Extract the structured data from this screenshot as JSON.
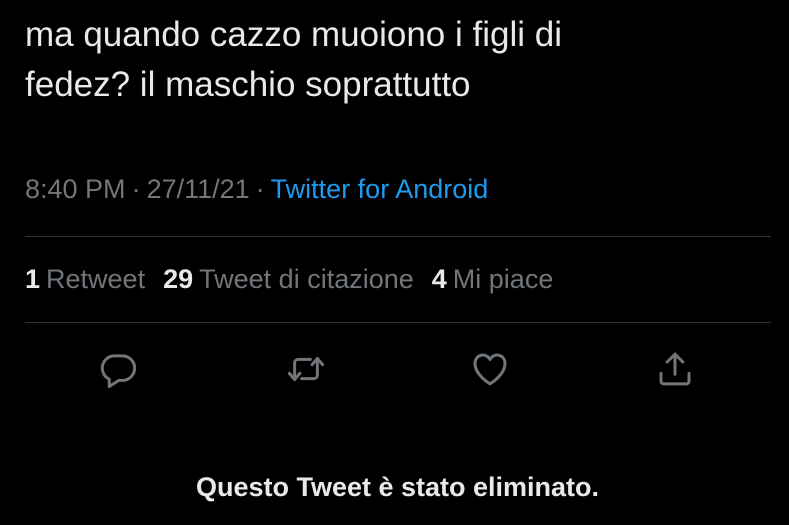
{
  "tweet": {
    "text": "ma quando cazzo muoiono i figli di\nfedez? il maschio soprattutto"
  },
  "meta": {
    "time": "8:40 PM",
    "separator": "·",
    "date": "27/11/21",
    "source": "Twitter for Android"
  },
  "stats": {
    "retweets_count": "1",
    "retweets_label": "Retweet",
    "quotes_count": "29",
    "quotes_label": "Tweet di citazione",
    "likes_count": "4",
    "likes_label": "Mi piace"
  },
  "actions": [
    {
      "icon": "reply-icon"
    },
    {
      "icon": "retweet-icon"
    },
    {
      "icon": "like-icon"
    },
    {
      "icon": "share-icon"
    }
  ],
  "notice": {
    "deleted": "Questo Tweet è stato eliminato."
  },
  "colors": {
    "background": "#000000",
    "text": "#e7e9ea",
    "secondary": "#71767b",
    "link": "#1d9bf0",
    "divider": "#2f3336"
  }
}
